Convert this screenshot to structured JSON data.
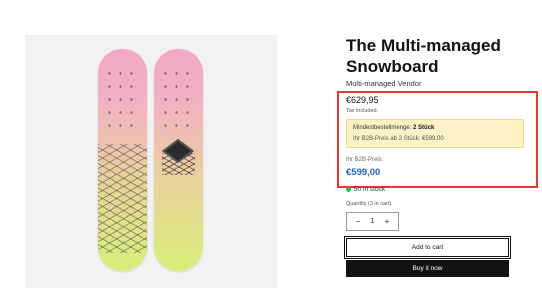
{
  "product": {
    "title": "The Multi-managed Snowboard",
    "vendor": "Multi-managed Vendor",
    "price": "€629,95",
    "tax_note": "Tax included.",
    "image_icon": "snowboard-image"
  },
  "b2b": {
    "min_order_label": "Mindestbestellmenge:",
    "min_order_value": "2 Stück",
    "b2b_tier": "Ihr B2B-Preis ab 2 Stück: €599,00",
    "price_label": "Ihr B2B-Preis:",
    "price": "€599,00"
  },
  "inventory": {
    "stock_text": "50 in stock",
    "stock_color": "#3bb14a"
  },
  "quantity": {
    "label": "Quantity (3 in cart)",
    "value": "1",
    "decrement": "−",
    "increment": "+"
  },
  "actions": {
    "add_to_cart": "Add to cart",
    "buy_now": "Buy it now"
  },
  "colors": {
    "highlight_border": "#e53935",
    "b2b_price": "#2563c9",
    "notice_bg": "#fdf2c6"
  }
}
